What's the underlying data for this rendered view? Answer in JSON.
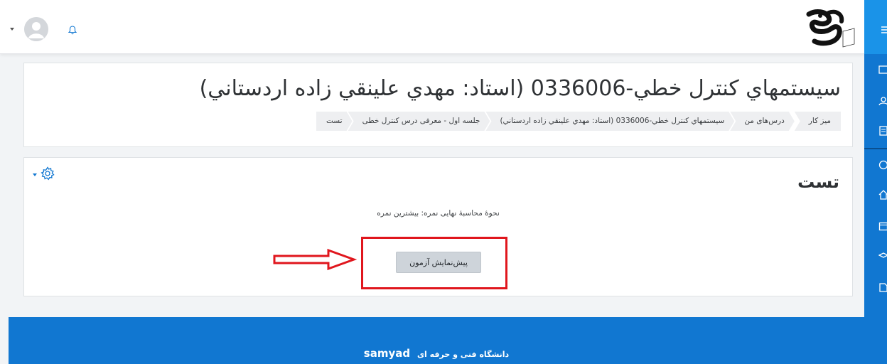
{
  "header": {
    "notifications_icon": "bell-icon",
    "avatar_icon": "user-avatar-icon",
    "logo_icon": "university-logo"
  },
  "course": {
    "title": "سيستمهاي كنترل خطي-0336006 (استاد: مهدي علينقي زاده اردستاني)"
  },
  "breadcrumb": [
    "ميز كار",
    "درس‌های من",
    "سيستمهاي كنترل خطي-0336006 (استاد: مهدي علينقي زاده اردستاني)",
    "جلسه اول - معرفی درس کنترل خطی",
    "تست"
  ],
  "activity": {
    "title": "تست",
    "grading_method": "نحوهٔ محاسبهٔ نهایی نمره: بیشترین نمره",
    "preview_button": "پیش‌نمایش آزمون",
    "settings_icon": "gear-icon"
  },
  "footer": {
    "brand_text": "دانشگاه فنی و حرفه ای",
    "brand_logo_text": "samyad"
  },
  "drawer": {
    "icons": [
      "menu-icon",
      "dashboard-icon",
      "user-icon",
      "courses-icon",
      "clock-icon",
      "home-icon",
      "calendar-icon",
      "graduation-icon",
      "files-icon"
    ]
  },
  "colors": {
    "primary": "#1177d1",
    "highlight_red": "#e0161d",
    "button_gray": "#ced4da"
  }
}
